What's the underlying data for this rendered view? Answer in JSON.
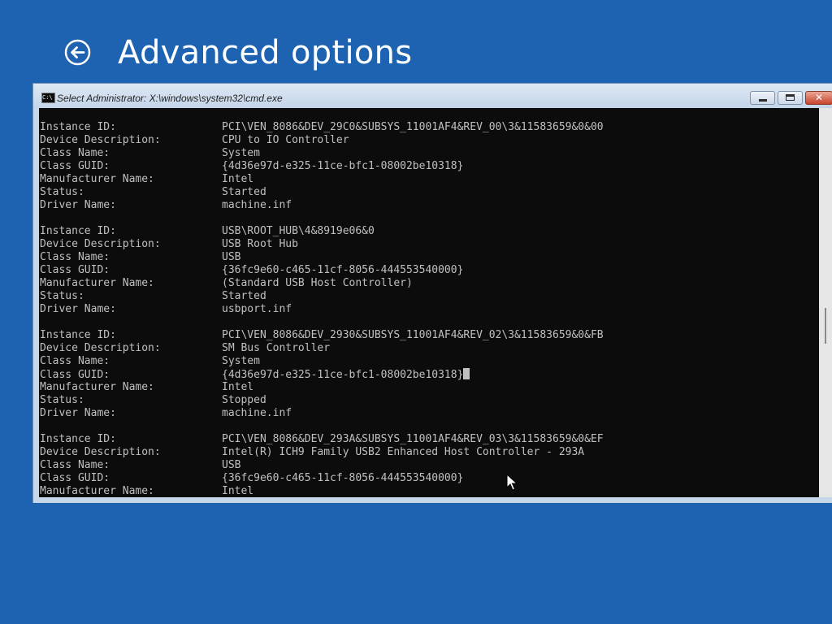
{
  "page": {
    "title": "Advanced options",
    "back_icon": "back-arrow-icon"
  },
  "window": {
    "title": "Select Administrator: X:\\windows\\system32\\cmd.exe",
    "icon_text": "C:\\",
    "buttons": {
      "minimize_icon": "minimize-icon",
      "maximize_icon": "maximize-icon",
      "close_icon": "close-icon",
      "close_glyph": "✕"
    }
  },
  "colors": {
    "desktop_background": "#1e63b1",
    "console_background": "#0c0c0c",
    "console_text": "#c0c0c0"
  },
  "console": {
    "devices": [
      {
        "instance_label": "Instance ID:",
        "instance_id": "PCI\\VEN_8086&DEV_29C0&SUBSYS_11001AF4&REV_00\\3&11583659&0&00",
        "description_label": "Device Description:",
        "description": "CPU to IO Controller",
        "class_label": "Class Name:",
        "class_name": "System",
        "guid_label": "Class GUID:",
        "class_guid": "{4d36e97d-e325-11ce-bfc1-08002be10318}",
        "manufacturer_label": "Manufacturer Name:",
        "manufacturer": "Intel",
        "status_label": "Status:",
        "status": "Started",
        "driver_label": "Driver Name:",
        "driver": "machine.inf"
      },
      {
        "instance_label": "Instance ID:",
        "instance_id": "USB\\ROOT_HUB\\4&8919e06&0",
        "description_label": "Device Description:",
        "description": "USB Root Hub",
        "class_label": "Class Name:",
        "class_name": "USB",
        "guid_label": "Class GUID:",
        "class_guid": "{36fc9e60-c465-11cf-8056-444553540000}",
        "manufacturer_label": "Manufacturer Name:",
        "manufacturer": "(Standard USB Host Controller)",
        "status_label": "Status:",
        "status": "Started",
        "driver_label": "Driver Name:",
        "driver": "usbport.inf"
      },
      {
        "instance_label": "Instance ID:",
        "instance_id": "PCI\\VEN_8086&DEV_2930&SUBSYS_11001AF4&REV_02\\3&11583659&0&FB",
        "description_label": "Device Description:",
        "description": "SM Bus Controller",
        "class_label": "Class Name:",
        "class_name": "System",
        "guid_label": "Class GUID:",
        "class_guid": "{4d36e97d-e325-11ce-bfc1-08002be10318}",
        "manufacturer_label": "Manufacturer Name:",
        "manufacturer": "Intel",
        "status_label": "Status:",
        "status": "Stopped",
        "driver_label": "Driver Name:",
        "driver": "machine.inf"
      },
      {
        "instance_label": "Instance ID:",
        "instance_id": "PCI\\VEN_8086&DEV_293A&SUBSYS_11001AF4&REV_03\\3&11583659&0&EF",
        "description_label": "Device Description:",
        "description": "Intel(R) ICH9 Family USB2 Enhanced Host Controller - 293A",
        "class_label": "Class Name:",
        "class_name": "USB",
        "guid_label": "Class GUID:",
        "class_guid": "{36fc9e60-c465-11cf-8056-444553540000}",
        "manufacturer_label": "Manufacturer Name:",
        "manufacturer": "Intel"
      }
    ]
  }
}
